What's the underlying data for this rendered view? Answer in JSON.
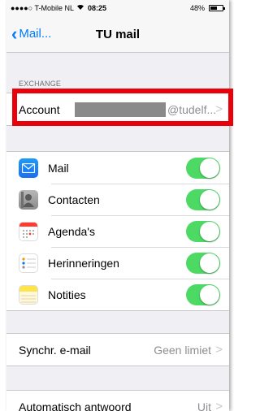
{
  "status_bar": {
    "carrier": "●●●●○ T-Mobile NL",
    "time": "08:25",
    "battery_percent": "48%",
    "wifi_icon": "wifi-icon",
    "battery_icon": "battery-icon"
  },
  "nav": {
    "back_label": "Mail...",
    "title": "TU mail"
  },
  "exchange": {
    "section_header": "EXCHANGE",
    "account_label": "Account",
    "account_value": "@tudelf...",
    "account_value_redacted": true
  },
  "services": [
    {
      "label": "Mail",
      "icon": "mail-icon",
      "enabled": true
    },
    {
      "label": "Contacten",
      "icon": "contacts-icon",
      "enabled": true
    },
    {
      "label": "Agenda's",
      "icon": "calendar-icon",
      "enabled": true
    },
    {
      "label": "Herinneringen",
      "icon": "reminders-icon",
      "enabled": true
    },
    {
      "label": "Notities",
      "icon": "notes-icon",
      "enabled": true
    }
  ],
  "sync": {
    "label": "Synchr. e-mail",
    "value": "Geen limiet"
  },
  "auto_reply": {
    "label": "Automatisch antwoord",
    "value": "Uit"
  },
  "colors": {
    "accent": "#007aff",
    "toggle_on": "#4cd964",
    "highlight": "#e8000b",
    "background": "#efeff4"
  }
}
